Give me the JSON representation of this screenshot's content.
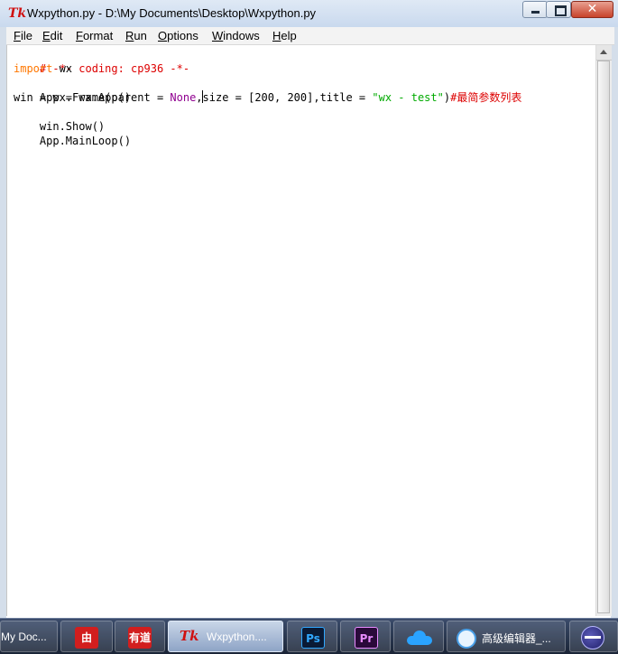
{
  "window": {
    "title": "Wxpython.py - D:\\My Documents\\Desktop\\Wxpython.py",
    "app_icon": "Tk",
    "controls": {
      "minimize": "minimize-icon",
      "maximize": "maximize-icon",
      "close": "✕"
    }
  },
  "menu": [
    "File",
    "Edit",
    "Format",
    "Run",
    "Options",
    "Windows",
    "Help"
  ],
  "code": {
    "line1": "# -*- coding: cp936 -*-",
    "line2_kw": "import",
    "line2_rest": " wx",
    "line3": "App = wx.App()",
    "line4_a": "win = wx.Frame(parent = ",
    "line4_none": "None",
    "line4_b": ",",
    "line4_c": "size = [200, 200],title = ",
    "line4_str": "\"wx - test\"",
    "line4_d": ")",
    "line4_comment": "#最简参数列表",
    "line5": "win.Show()",
    "line6": "App.MainLoop()"
  },
  "taskbar": {
    "items": [
      {
        "label": "My Doc...",
        "icon": "folder-icon"
      },
      {
        "label": "由",
        "icon": "app-icon"
      },
      {
        "label": "有道",
        "icon": "youdao-icon"
      },
      {
        "label": "Wxpython....",
        "icon": "tk-icon"
      },
      {
        "label": "Ps",
        "icon": "photoshop-icon"
      },
      {
        "label": "Pr",
        "icon": "premiere-icon"
      },
      {
        "label": "",
        "icon": "baidu-cloud-icon"
      },
      {
        "label": "高级编辑器_...",
        "icon": "qq-browser-icon"
      },
      {
        "label": "",
        "icon": "eclipse-icon"
      }
    ]
  },
  "colors": {
    "comment": "#dd0000",
    "keyword": "#ff7700",
    "builtin": "#900090",
    "string": "#00aa00"
  }
}
